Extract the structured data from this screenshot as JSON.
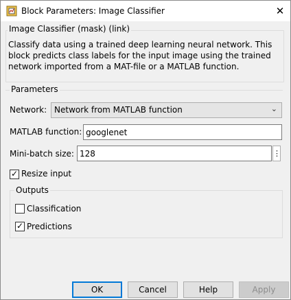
{
  "window": {
    "title": "Block Parameters: Image Classifier",
    "icon": "simulink-block-icon"
  },
  "description": {
    "group_title": "Image Classifier (mask) (link)",
    "text": "Classify data using a trained deep learning neural network. This block predicts class labels for the input image using the trained network imported from a MAT-file or a MATLAB function."
  },
  "parameters": {
    "section_title": "Parameters",
    "network": {
      "label": "Network:",
      "selected": "Network from MATLAB function"
    },
    "matlab_function": {
      "label": "MATLAB function:",
      "value": "googlenet"
    },
    "mini_batch_size": {
      "label": "Mini-batch size:",
      "value": "128"
    },
    "resize_input": {
      "label": "Resize input",
      "checked": true
    }
  },
  "outputs": {
    "title": "Outputs",
    "classification": {
      "label": "Classification",
      "checked": false
    },
    "predictions": {
      "label": "Predictions",
      "checked": true
    }
  },
  "buttons": {
    "ok": "OK",
    "cancel": "Cancel",
    "help": "Help",
    "apply": "Apply"
  },
  "colors": {
    "client_background": "#f0f0f0",
    "focus_border": "#0078d7"
  }
}
